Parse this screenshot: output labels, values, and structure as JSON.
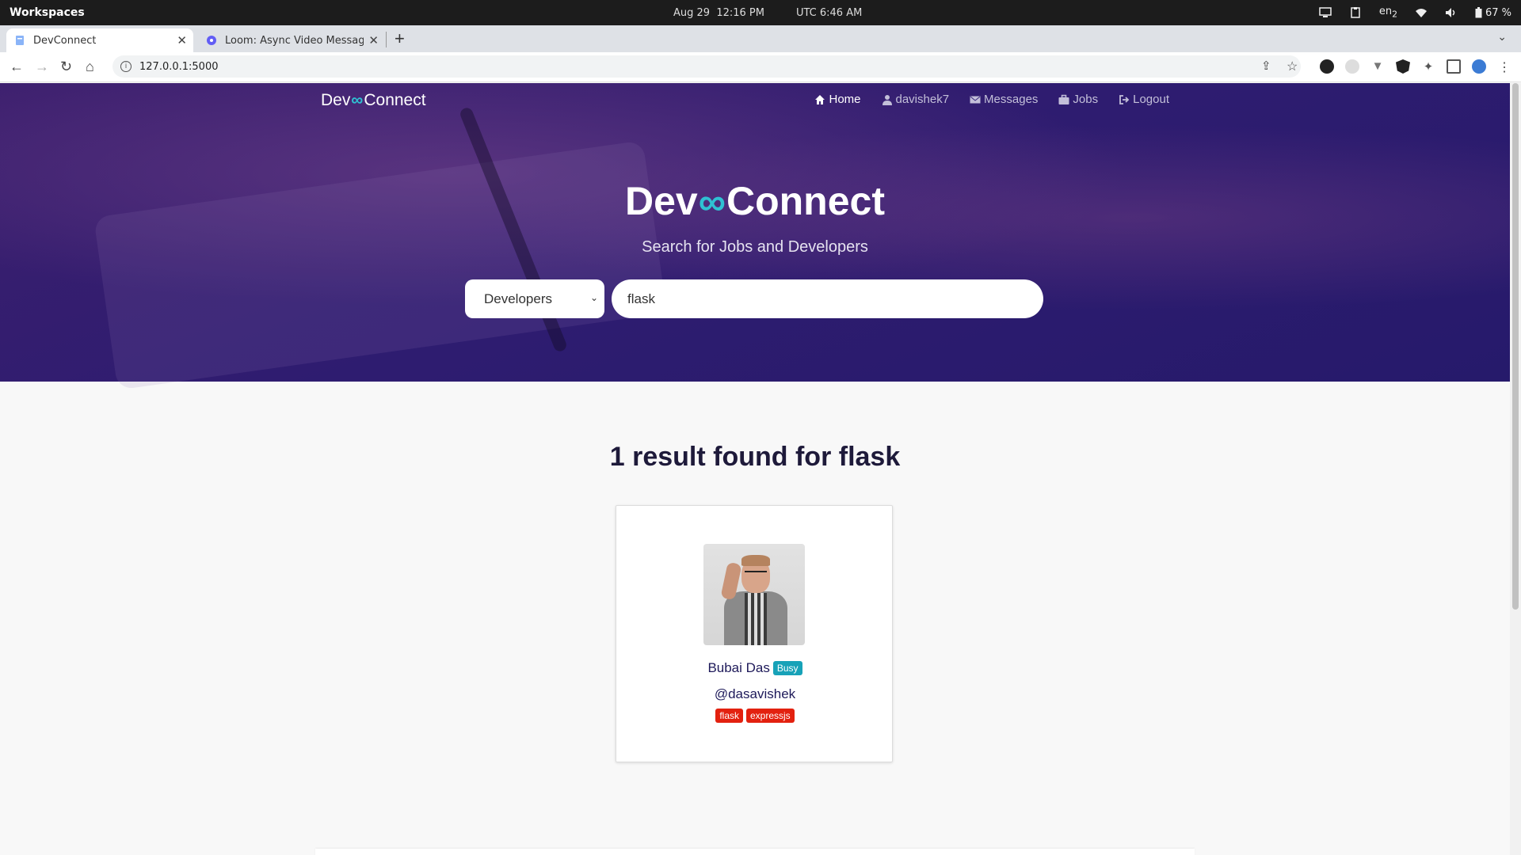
{
  "os": {
    "workspaces": "Workspaces",
    "date": "Aug 29",
    "time": "12:16 PM",
    "utc": "UTC 6:46 AM",
    "lang": "en",
    "lang_sub": "2",
    "battery": "67 %"
  },
  "browser": {
    "tabs": [
      {
        "title": "DevConnect",
        "active": true
      },
      {
        "title": "Loom: Async Video Messaging",
        "active": false
      }
    ],
    "url": "127.0.0.1:5000"
  },
  "site": {
    "logo_left": "Dev",
    "logo_right": "Connect",
    "nav": [
      {
        "label": "Home",
        "icon": "home-icon",
        "active": true
      },
      {
        "label": "davishek7",
        "icon": "user-icon",
        "active": false
      },
      {
        "label": "Messages",
        "icon": "envelope-icon",
        "active": false
      },
      {
        "label": "Jobs",
        "icon": "briefcase-icon",
        "active": false
      },
      {
        "label": "Logout",
        "icon": "logout-icon",
        "active": false
      }
    ],
    "hero_title_left": "Dev",
    "hero_title_right": "Connect",
    "hero_subtitle": "Search for Jobs and Developers",
    "search_type": "Developers",
    "search_query": "flask"
  },
  "results": {
    "heading": "1 result found for flask",
    "developers": [
      {
        "name": "Bubai Das",
        "status": "Busy",
        "handle": "@dasavishek",
        "tags": [
          "flask",
          "expressjs"
        ]
      }
    ]
  },
  "colors": {
    "accent": "#2fc1d3",
    "hero": "#2e1c70",
    "tag": "#e3210f",
    "badge": "#17a2b8"
  }
}
